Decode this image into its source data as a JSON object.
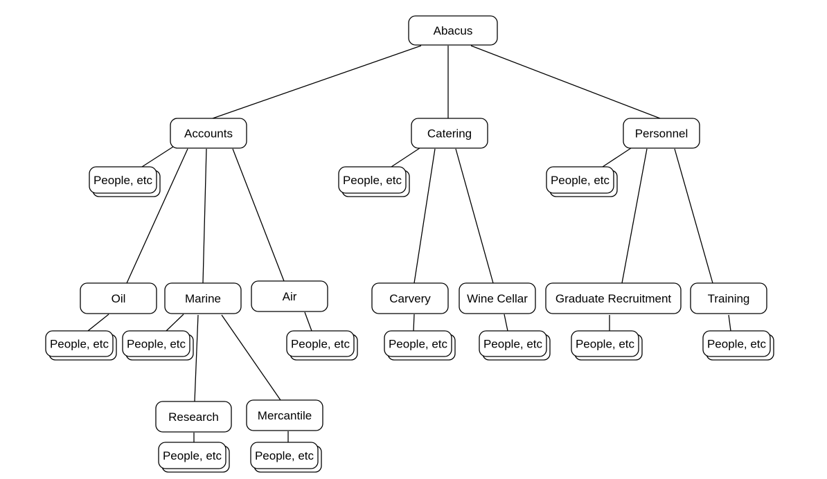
{
  "diagram": {
    "type": "org-chart",
    "nodes": [
      {
        "id": "abacus",
        "label": "Abacus",
        "parent": null
      },
      {
        "id": "accounts",
        "label": "Accounts",
        "parent": "abacus"
      },
      {
        "id": "catering",
        "label": "Catering",
        "parent": "abacus"
      },
      {
        "id": "personnel",
        "label": "Personnel",
        "parent": "abacus"
      },
      {
        "id": "accounts-people",
        "label": "People, etc",
        "parent": "accounts",
        "stacked": true
      },
      {
        "id": "catering-people",
        "label": "People, etc",
        "parent": "catering",
        "stacked": true
      },
      {
        "id": "personnel-people",
        "label": "People, etc",
        "parent": "personnel",
        "stacked": true
      },
      {
        "id": "oil",
        "label": "Oil",
        "parent": "accounts"
      },
      {
        "id": "marine",
        "label": "Marine",
        "parent": "accounts"
      },
      {
        "id": "air",
        "label": "Air",
        "parent": "accounts"
      },
      {
        "id": "carvery",
        "label": "Carvery",
        "parent": "catering"
      },
      {
        "id": "wine-cellar",
        "label": "Wine Cellar",
        "parent": "catering"
      },
      {
        "id": "graduate-recruitment",
        "label": "Graduate Recruitment",
        "parent": "personnel"
      },
      {
        "id": "training",
        "label": "Training",
        "parent": "personnel"
      },
      {
        "id": "oil-people",
        "label": "People, etc",
        "parent": "oil",
        "stacked": true
      },
      {
        "id": "marine-people",
        "label": "People, etc",
        "parent": "marine",
        "stacked": true
      },
      {
        "id": "air-people",
        "label": "People, etc",
        "parent": "air",
        "stacked": true
      },
      {
        "id": "carvery-people",
        "label": "People, etc",
        "parent": "carvery",
        "stacked": true
      },
      {
        "id": "wine-cellar-people",
        "label": "People, etc",
        "parent": "wine-cellar",
        "stacked": true
      },
      {
        "id": "graduate-recruitment-people",
        "label": "People, etc",
        "parent": "graduate-recruitment",
        "stacked": true
      },
      {
        "id": "training-people",
        "label": "People, etc",
        "parent": "training",
        "stacked": true
      },
      {
        "id": "research",
        "label": "Research",
        "parent": "marine"
      },
      {
        "id": "mercantile",
        "label": "Mercantile",
        "parent": "marine"
      },
      {
        "id": "research-people",
        "label": "People, etc",
        "parent": "research",
        "stacked": true
      },
      {
        "id": "mercantile-people",
        "label": "People, etc",
        "parent": "mercantile",
        "stacked": true
      }
    ]
  }
}
